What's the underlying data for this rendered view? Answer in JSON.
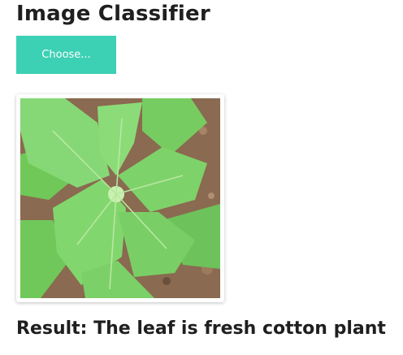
{
  "header": {
    "title": "Image Classifier"
  },
  "upload": {
    "button_label": "Choose..."
  },
  "preview": {
    "image_name": "cotton-leaf-photo"
  },
  "result": {
    "text": "Result: The leaf is fresh cotton plant"
  },
  "colors": {
    "accent": "#3cd0b4",
    "leaf": "#7ed26a",
    "soil": "#8a6a50"
  }
}
